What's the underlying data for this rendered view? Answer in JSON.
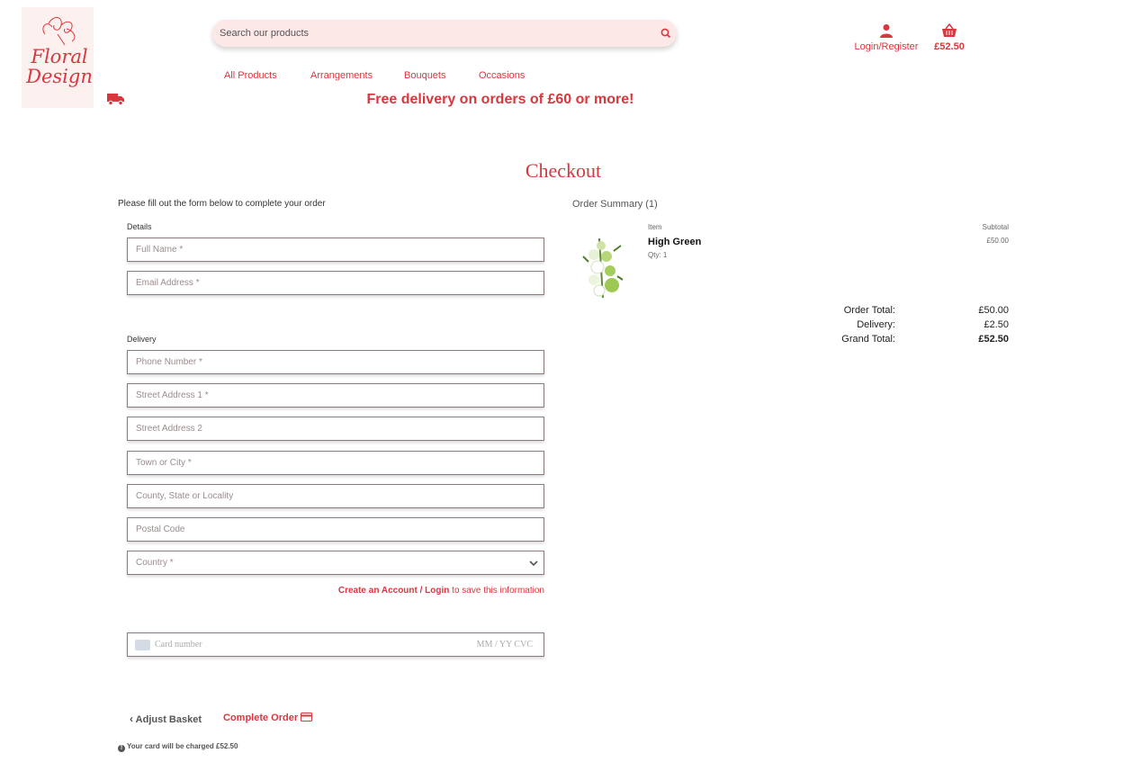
{
  "brand": {
    "logo_text_line1": "Floral",
    "logo_text_line2": "Design"
  },
  "search": {
    "placeholder": "Search our products"
  },
  "account": {
    "label": "Login/Register"
  },
  "basket": {
    "total": "£52.50"
  },
  "nav": {
    "items": [
      "All Products",
      "Arrangements",
      "Bouquets",
      "Occasions"
    ]
  },
  "banner": {
    "text": "Free delivery on orders of £60 or more!"
  },
  "page": {
    "title": "Checkout"
  },
  "form": {
    "intro": "Please fill out the form below to complete your order",
    "details_label": "Details",
    "full_name_placeholder": "Full Name *",
    "email_placeholder": "Email Address *",
    "delivery_label": "Delivery",
    "phone_placeholder": "Phone Number *",
    "street1_placeholder": "Street Address 1 *",
    "street2_placeholder": "Street Address 2",
    "town_placeholder": "Town or City *",
    "county_placeholder": "County, State or Locality",
    "postal_placeholder": "Postal Code",
    "country_placeholder": "Country *",
    "save_link_text": "Create an Account / Login",
    "save_suffix": " to save this information",
    "card_number_placeholder": "Card number",
    "card_expiry_cvc": "MM / YY  CVC",
    "adjust_label": "Adjust Basket",
    "complete_label": "Complete Order",
    "charge_note": "Your card will be charged £52.50"
  },
  "summary": {
    "title": "Order Summary (1)",
    "item_header": "Item",
    "subtotal_header": "Subtotal",
    "item_name": "High Green",
    "item_qty": "Qty: 1",
    "item_subtotal": "£50.00",
    "order_total_label": "Order Total:",
    "order_total": "£50.00",
    "delivery_label": "Delivery:",
    "delivery": "£2.50",
    "grand_total_label": "Grand Total:",
    "grand_total": "£52.50"
  },
  "colors": {
    "accent": "#d9363e",
    "search_bg": "#fbe8e7"
  }
}
